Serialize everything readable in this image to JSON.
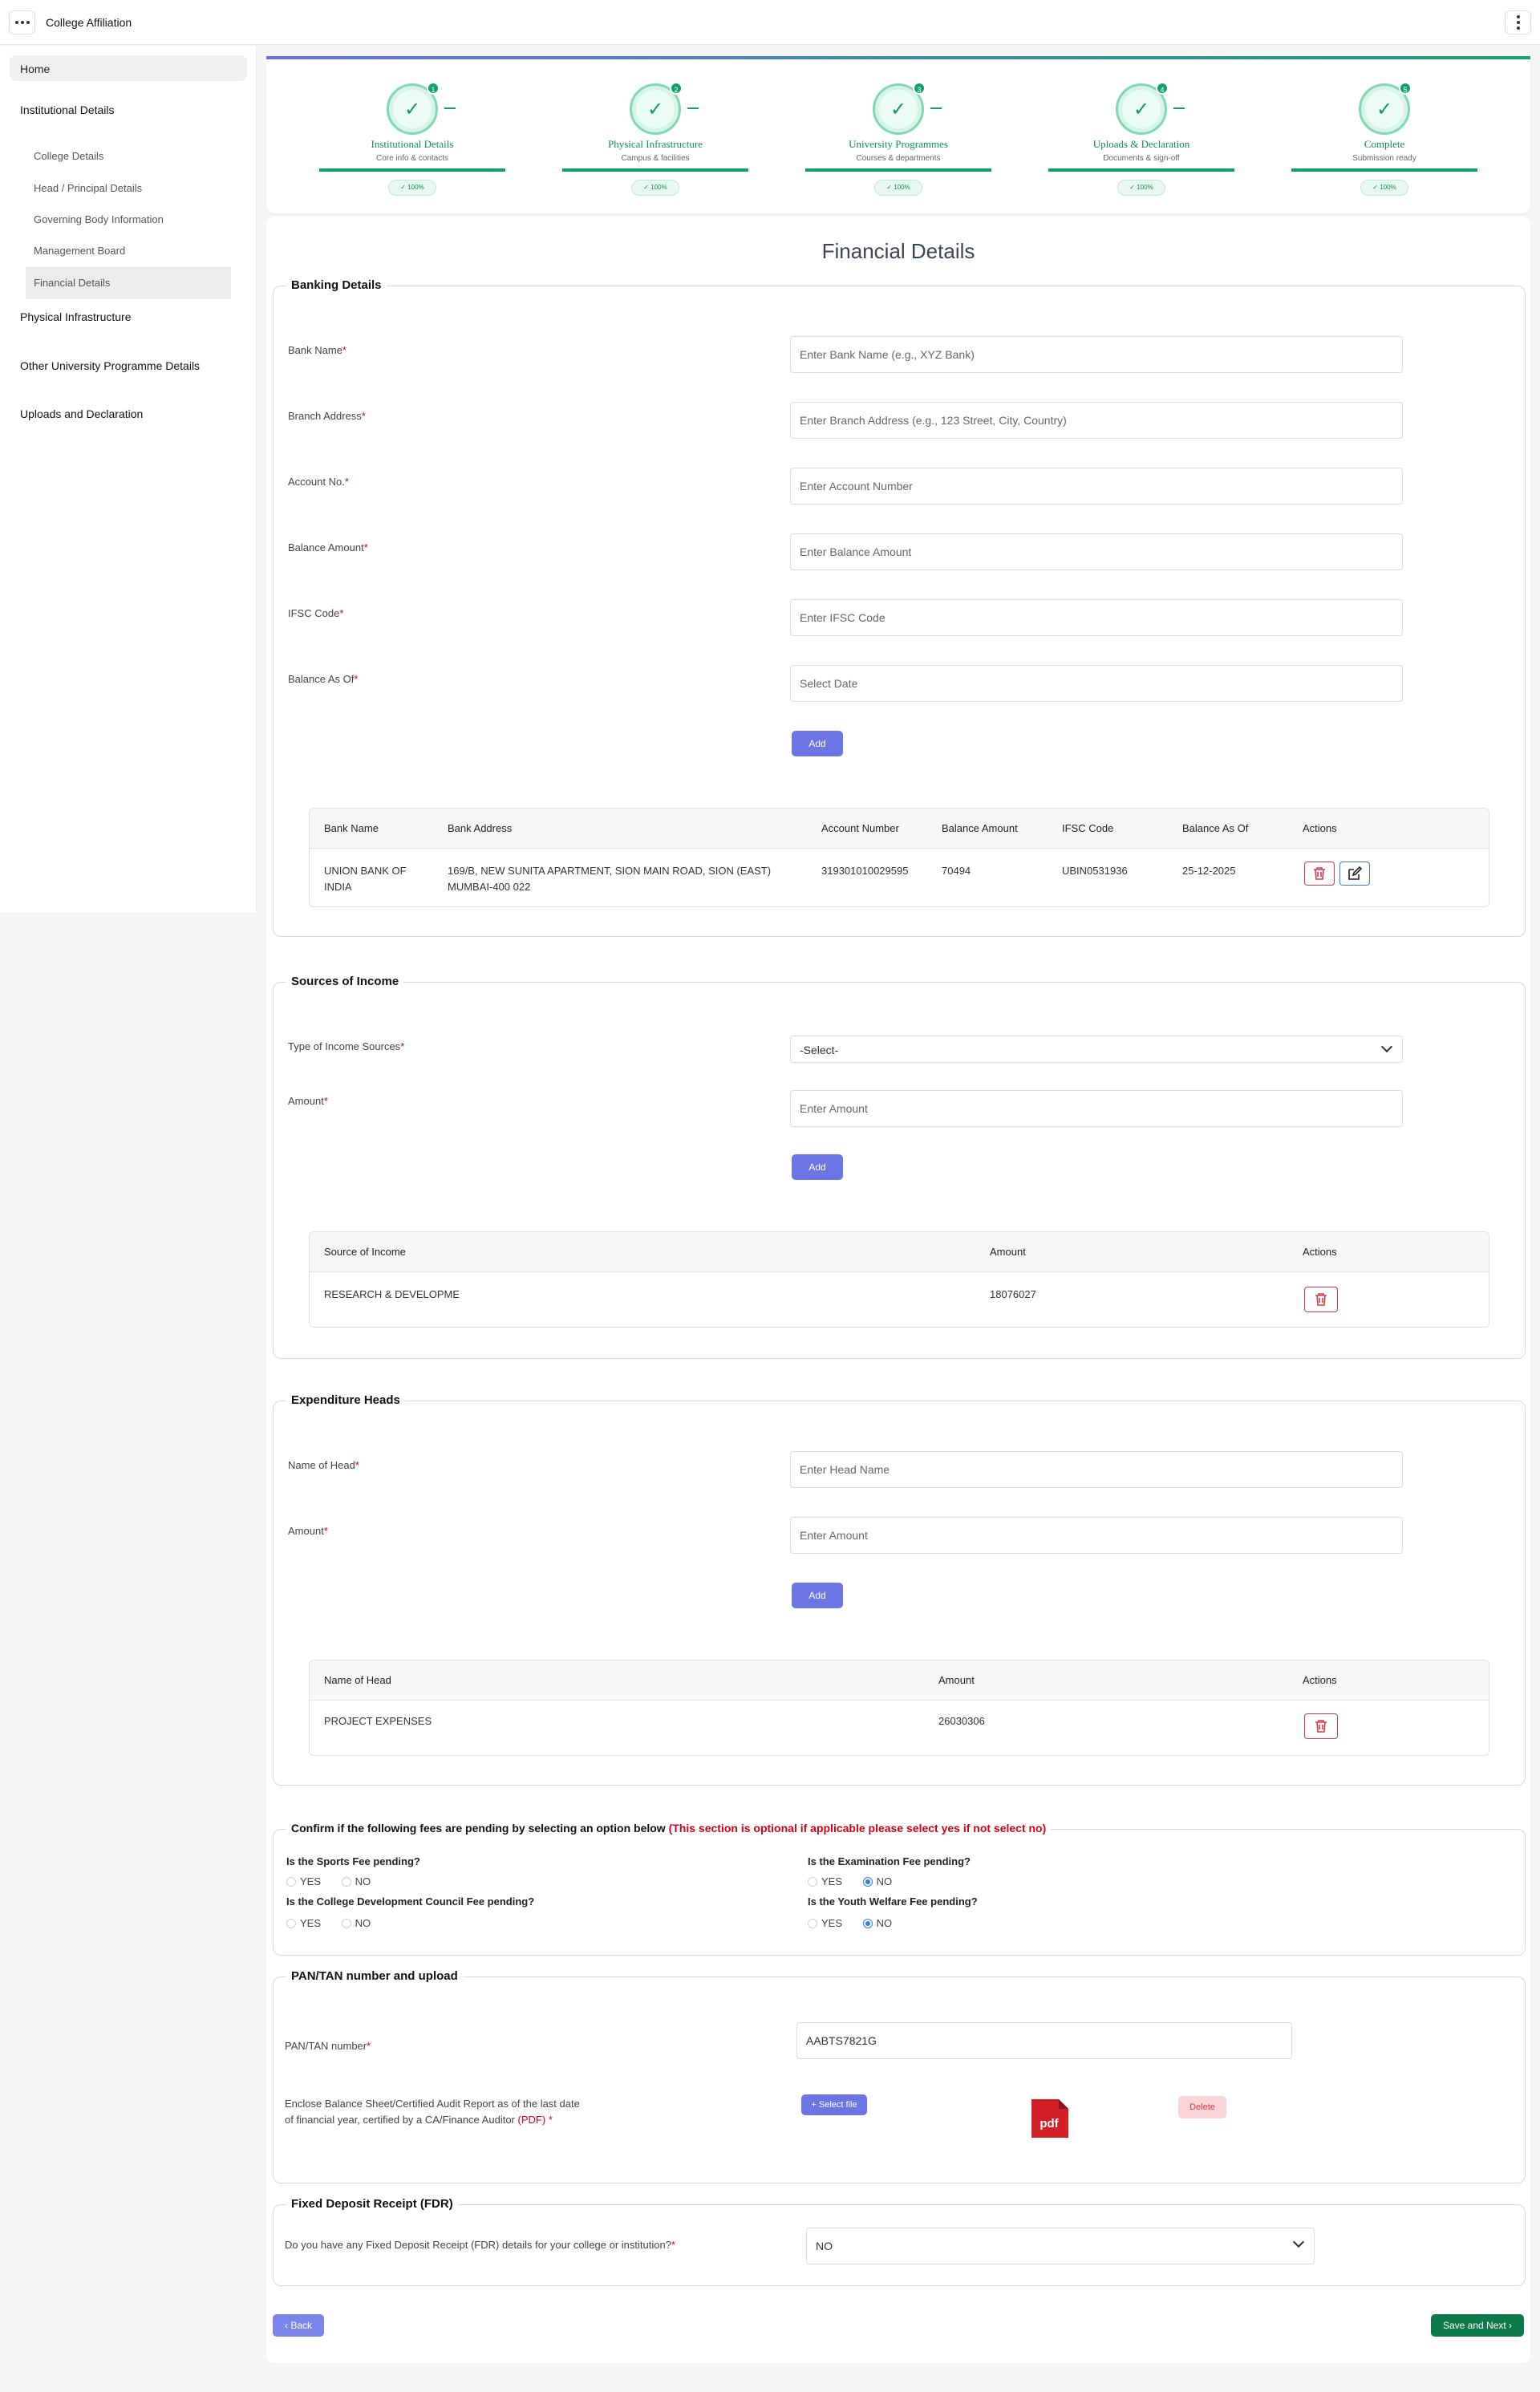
{
  "app": {
    "title": "College Affiliation"
  },
  "sidebar": {
    "home": "Home",
    "sections": [
      {
        "label": "Institutional Details"
      },
      {
        "label": "Physical Infrastructure"
      },
      {
        "label": "Other University Programme Details"
      },
      {
        "label": "Uploads and Declaration"
      }
    ],
    "items": [
      {
        "label": "College Details"
      },
      {
        "label": "Head / Principal Details"
      },
      {
        "label": "Governing Body Information"
      },
      {
        "label": "Management Board"
      },
      {
        "label": "Financial Details"
      }
    ]
  },
  "stepper": {
    "steps": [
      {
        "num": "1",
        "title": "Institutional Details",
        "sub": "Core info & contacts",
        "pct": "✓ 100%"
      },
      {
        "num": "2",
        "title": "Physical Infrastructure",
        "sub": "Campus & facilities",
        "pct": "✓ 100%"
      },
      {
        "num": "3",
        "title": "University Programmes",
        "sub": "Courses & departments",
        "pct": "✓ 100%"
      },
      {
        "num": "4",
        "title": "Uploads & Declaration",
        "sub": "Documents & sign-off",
        "pct": "✓ 100%"
      },
      {
        "num": "5",
        "title": "Complete",
        "sub": "Submission ready",
        "pct": "✓ 100%"
      }
    ]
  },
  "page": {
    "title": "Financial Details"
  },
  "banking": {
    "legend": "Banking Details",
    "fields": [
      {
        "label": "Bank Name",
        "placeholder": "Enter Bank Name (e.g., XYZ Bank)"
      },
      {
        "label": "Branch Address",
        "placeholder": "Enter Branch Address (e.g., 123 Street, City, Country)"
      },
      {
        "label": "Account No.",
        "placeholder": "Enter Account Number"
      },
      {
        "label": "Balance Amount",
        "placeholder": "Enter Balance Amount"
      },
      {
        "label": "IFSC Code",
        "placeholder": "Enter IFSC Code"
      },
      {
        "label": "Balance As Of",
        "placeholder": "Select Date"
      }
    ],
    "add_label": "Add",
    "table": {
      "headers": [
        "Bank Name",
        "Bank Address",
        "Account Number",
        "Balance Amount",
        "IFSC Code",
        "Balance As Of",
        "Actions"
      ],
      "row": {
        "bank_name_1": "UNION BANK OF",
        "bank_name_2": "INDIA",
        "address_1": "169/B, NEW SUNITA APARTMENT, SION MAIN ROAD, SION (EAST)",
        "address_2": "MUMBAI-400 022",
        "account": "319301010029595",
        "balance": "70494",
        "ifsc": "UBIN0531936",
        "as_of": "25-12-2025"
      }
    }
  },
  "income": {
    "legend": "Sources of Income",
    "type_label": "Type of Income Sources",
    "type_value": "-Select-",
    "amount_label": "Amount",
    "amount_placeholder": "Enter Amount",
    "add_label": "Add",
    "table": {
      "headers": [
        "Source of Income",
        "Amount",
        "Actions"
      ],
      "row": {
        "source": "RESEARCH & DEVELOPME",
        "amount": "18076027"
      }
    }
  },
  "expenditure": {
    "legend": "Expenditure Heads",
    "name_label": "Name of Head",
    "name_placeholder": "Enter Head Name",
    "amount_label": "Amount",
    "amount_placeholder": "Enter Amount",
    "add_label": "Add",
    "table": {
      "headers": [
        "Name of Head",
        "Amount",
        "Actions"
      ],
      "row": {
        "name": "PROJECT EXPENSES",
        "amount": "26030306"
      }
    }
  },
  "fees": {
    "legend": "Confirm if the following fees are pending by selecting an option below",
    "note": "(This section is optional if applicable please select yes if not select no)",
    "yes": "YES",
    "no": "NO",
    "questions": [
      {
        "q": "Is the Sports Fee pending?",
        "selected": ""
      },
      {
        "q": "Is the Examination Fee pending?",
        "selected": "NO"
      },
      {
        "q": "Is the College Development Council Fee pending?",
        "selected": ""
      },
      {
        "q": "Is the Youth Welfare Fee pending?",
        "selected": "NO"
      }
    ]
  },
  "pan": {
    "legend": "PAN/TAN number and upload",
    "label": "PAN/TAN number",
    "value": "AABTS7821G",
    "enclose_1": "Enclose Balance Sheet/Certified Audit Report as of the last date",
    "enclose_2": "of financial year, certified by a CA/Finance Auditor",
    "pdf_note": "(PDF)",
    "select_file": "+ Select file",
    "pdf_label": "pdf",
    "delete": "Delete"
  },
  "fdr": {
    "legend": "Fixed Deposit Receipt (FDR)",
    "question": "Do you have any Fixed Deposit Receipt (FDR) details for your college or institution?",
    "value": "NO"
  },
  "nav": {
    "back": "‹ Back",
    "save": "Save and Next ›"
  },
  "colors": {
    "primary": "#6c74e6",
    "success": "#0e7a49",
    "danger": "#d23a4c",
    "step_green": "#12a06a"
  }
}
